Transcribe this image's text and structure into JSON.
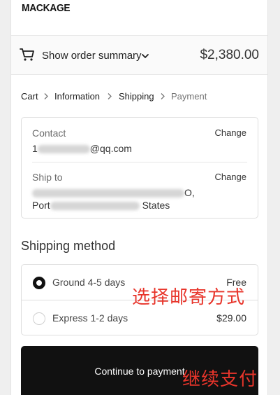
{
  "header": {
    "logo_text": "MACKAGE"
  },
  "summary": {
    "toggle_label": "Show order summary",
    "total": "$2,380.00"
  },
  "breadcrumb": [
    {
      "label": "Cart"
    },
    {
      "label": "Information"
    },
    {
      "label": "Shipping"
    },
    {
      "label": "Payment"
    }
  ],
  "review": {
    "contact_label": "Contact",
    "contact_value_prefix": "1",
    "contact_value_suffix": "@qq.com",
    "ship_label": "Ship to",
    "ship_line1_suffix": "O,",
    "ship_line2_prefix": "Port",
    "ship_line2_suffix": "States",
    "change_label": "Change"
  },
  "shipping": {
    "title": "Shipping method",
    "options": [
      {
        "label": "Ground 4-5 days",
        "price": "Free",
        "selected": true
      },
      {
        "label": "Express 1-2 days",
        "price": "$29.00",
        "selected": false
      }
    ]
  },
  "actions": {
    "continue_label": "Continue to payment"
  },
  "annotations": {
    "shipping_note": "选择邮寄方式",
    "payment_note": "继续支付"
  },
  "colors": {
    "button_bg": "#111111",
    "annotation": "#e8352b"
  }
}
